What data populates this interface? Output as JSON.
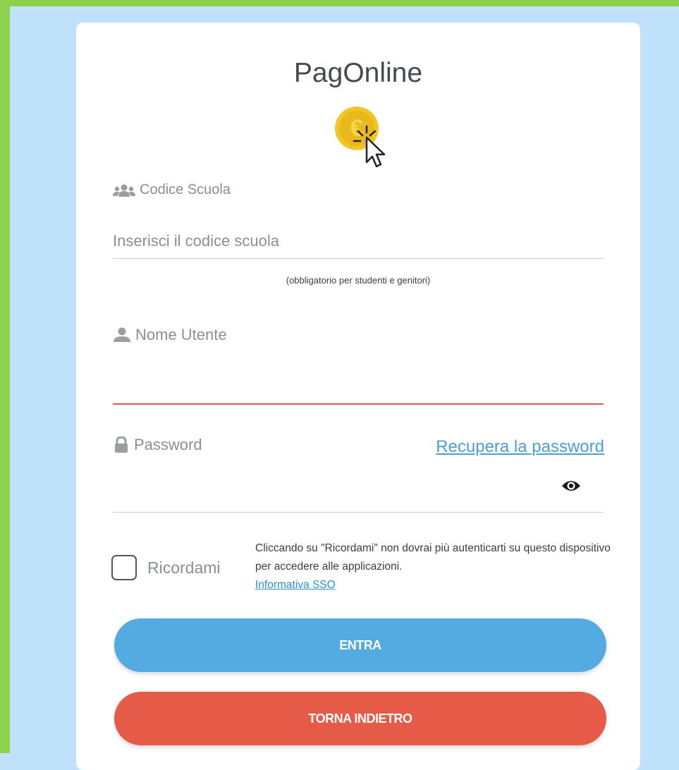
{
  "app": {
    "title": "PagOnline"
  },
  "logo": {
    "icon": "euro-coin-cursor-icon",
    "coin_color": "#f2c623"
  },
  "school_code": {
    "icon": "users-icon",
    "label": "Codice Scuola",
    "placeholder": "Inserisci il codice scuola",
    "value": "",
    "hint": "(obbligatorio per studenti e genitori)"
  },
  "username": {
    "icon": "user-icon",
    "label": "Nome Utente",
    "value": "",
    "underline_color": "#e8584a"
  },
  "password": {
    "icon": "lock-icon",
    "label": "Password",
    "value": "",
    "recover_link": "Recupera la password",
    "toggle_icon": "eye-icon"
  },
  "remember": {
    "label": "Ricordami",
    "checked": false,
    "note": "Cliccando su \"Ricordami\" non dovrai più autenticarti su questo dispositivo per accedere alle applicazioni.",
    "sso_link": "Informativa SSO"
  },
  "buttons": {
    "enter": {
      "label": "ENTRA",
      "color": "#54abe1"
    },
    "back": {
      "label": "TORNA INDIETRO",
      "color": "#e65b47"
    }
  },
  "colors": {
    "page_bg": "#bfe2fa",
    "frame": "#8cd24c",
    "link": "#4a9fd6"
  }
}
